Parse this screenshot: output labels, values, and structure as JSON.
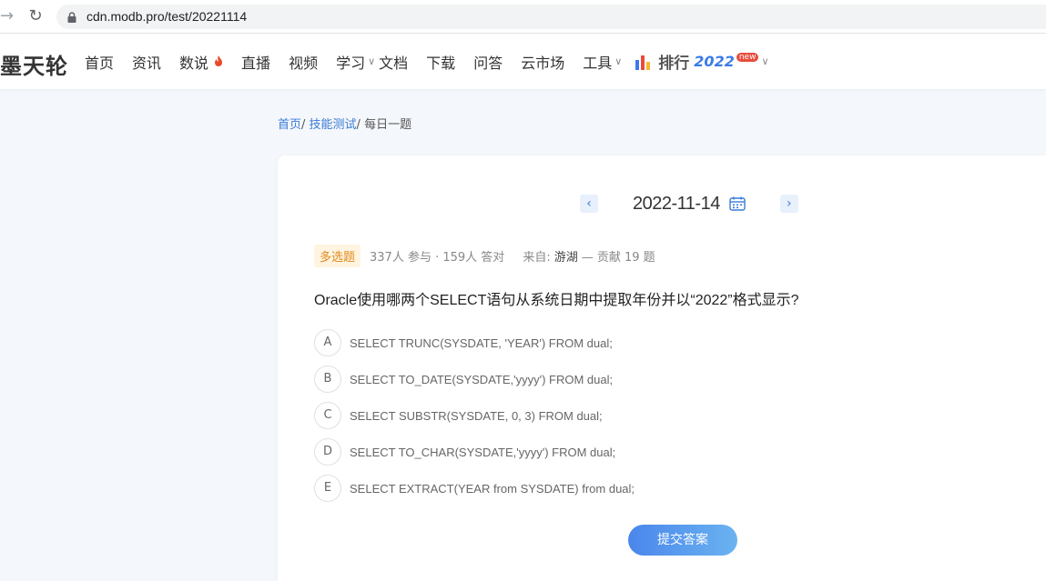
{
  "browser": {
    "url": "cdn.modb.pro/test/20221114"
  },
  "site": {
    "logo": "墨天轮",
    "nav": [
      {
        "label": "首页"
      },
      {
        "label": "资讯"
      },
      {
        "label": "数说"
      },
      {
        "label": "直播"
      },
      {
        "label": "视频"
      },
      {
        "label": "学习"
      },
      {
        "label": "文档"
      },
      {
        "label": "下载"
      },
      {
        "label": "问答"
      },
      {
        "label": "云市场"
      },
      {
        "label": "工具"
      }
    ],
    "rank": {
      "label": "排行",
      "year": "2022",
      "badge": "new"
    }
  },
  "breadcrumb": {
    "home": "首页",
    "sep1": "/ ",
    "skill": "技能测试",
    "sep2": "/ ",
    "current": "每日一题"
  },
  "quiz": {
    "date": "2022-11-14",
    "type": "多选题",
    "stats": "337人 参与 · 159人 答对",
    "from_label": "来自:",
    "author": "游湖",
    "contrib": "— 贡献 19 题",
    "question": "Oracle使用哪两个SELECT语句从系统日期中提取年份并以“2022”格式显示?",
    "options": [
      {
        "letter": "A",
        "text": "SELECT TRUNC(SYSDATE, 'YEAR') FROM dual;"
      },
      {
        "letter": "B",
        "text": "SELECT TO_DATE(SYSDATE,'yyyy') FROM dual;"
      },
      {
        "letter": "C",
        "text": "SELECT SUBSTR(SYSDATE, 0, 3) FROM dual;"
      },
      {
        "letter": "D",
        "text": "SELECT TO_CHAR(SYSDATE,'yyyy') FROM dual;"
      },
      {
        "letter": "E",
        "text": "SELECT EXTRACT(YEAR from SYSDATE) from dual;"
      }
    ],
    "submit_label": "提交答案"
  },
  "colors": {
    "accent": "#3a7bd5",
    "type_badge_bg": "#fff4e0",
    "type_badge_text": "#e08a1e"
  }
}
